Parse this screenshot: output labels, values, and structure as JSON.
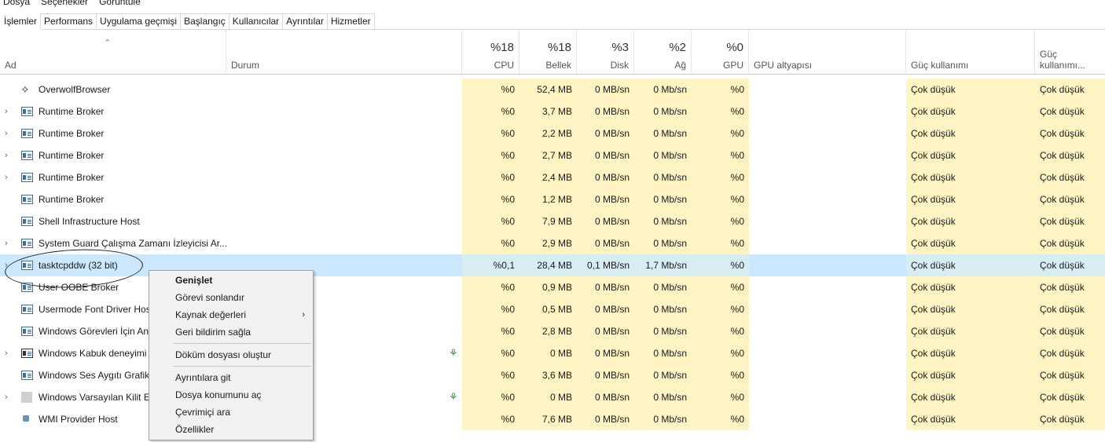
{
  "menu": [
    "Dosya",
    "Seçenekler",
    "Görüntüle"
  ],
  "tabs": [
    "İşlemler",
    "Performans",
    "Uygulama geçmişi",
    "Başlangıç",
    "Kullanıcılar",
    "Ayrıntılar",
    "Hizmetler"
  ],
  "columns": {
    "name": "Ad",
    "status": "Durum",
    "cpu": {
      "pct": "%18",
      "label": "CPU"
    },
    "memory": {
      "pct": "%18",
      "label": "Bellek"
    },
    "disk": {
      "pct": "%3",
      "label": "Disk"
    },
    "network": {
      "pct": "%2",
      "label": "Ağ"
    },
    "gpu": {
      "pct": "%0",
      "label": "GPU"
    },
    "gpu_engine": "GPU altyapısı",
    "power": "Güç kullanımı",
    "power_trend": "Güç kullanımı..."
  },
  "rows": [
    {
      "name": "OverwolfBrowser",
      "expand": false,
      "icon": "overwolf",
      "leaf": false,
      "cpu": "%0",
      "mem": "52,4 MB",
      "disk": "0 MB/sn",
      "net": "0 Mb/sn",
      "gpu": "%0",
      "power": "Çok düşük",
      "power2": "Çok düşük",
      "selected": false
    },
    {
      "name": "Runtime Broker",
      "expand": true,
      "icon": "process",
      "leaf": false,
      "cpu": "%0",
      "mem": "3,7 MB",
      "disk": "0 MB/sn",
      "net": "0 Mb/sn",
      "gpu": "%0",
      "power": "Çok düşük",
      "power2": "Çok düşük",
      "selected": false
    },
    {
      "name": "Runtime Broker",
      "expand": true,
      "icon": "process",
      "leaf": false,
      "cpu": "%0",
      "mem": "2,2 MB",
      "disk": "0 MB/sn",
      "net": "0 Mb/sn",
      "gpu": "%0",
      "power": "Çok düşük",
      "power2": "Çok düşük",
      "selected": false
    },
    {
      "name": "Runtime Broker",
      "expand": true,
      "icon": "process",
      "leaf": false,
      "cpu": "%0",
      "mem": "2,7 MB",
      "disk": "0 MB/sn",
      "net": "0 Mb/sn",
      "gpu": "%0",
      "power": "Çok düşük",
      "power2": "Çok düşük",
      "selected": false
    },
    {
      "name": "Runtime Broker",
      "expand": true,
      "icon": "process",
      "leaf": false,
      "cpu": "%0",
      "mem": "2,4 MB",
      "disk": "0 MB/sn",
      "net": "0 Mb/sn",
      "gpu": "%0",
      "power": "Çok düşük",
      "power2": "Çok düşük",
      "selected": false
    },
    {
      "name": "Runtime Broker",
      "expand": false,
      "icon": "process",
      "leaf": false,
      "cpu": "%0",
      "mem": "1,2 MB",
      "disk": "0 MB/sn",
      "net": "0 Mb/sn",
      "gpu": "%0",
      "power": "Çok düşük",
      "power2": "Çok düşük",
      "selected": false
    },
    {
      "name": "Shell Infrastructure Host",
      "expand": false,
      "icon": "process",
      "leaf": false,
      "cpu": "%0",
      "mem": "7,9 MB",
      "disk": "0 MB/sn",
      "net": "0 Mb/sn",
      "gpu": "%0",
      "power": "Çok düşük",
      "power2": "Çok düşük",
      "selected": false
    },
    {
      "name": "System Guard Çalışma Zamanı İzleyicisi Ar...",
      "expand": true,
      "icon": "process",
      "leaf": false,
      "cpu": "%0",
      "mem": "2,9 MB",
      "disk": "0 MB/sn",
      "net": "0 Mb/sn",
      "gpu": "%0",
      "power": "Çok düşük",
      "power2": "Çok düşük",
      "selected": false
    },
    {
      "name": "tasktcpddw (32 bit)",
      "expand": true,
      "icon": "process",
      "leaf": false,
      "cpu": "%0,1",
      "mem": "28,4 MB",
      "disk": "0,1 MB/sn",
      "net": "1,7 Mb/sn",
      "gpu": "%0",
      "power": "Çok düşük",
      "power2": "Çok düşük",
      "selected": true
    },
    {
      "name": "User OOBE Broker",
      "expand": false,
      "icon": "process",
      "leaf": false,
      "cpu": "%0",
      "mem": "0,9 MB",
      "disk": "0 MB/sn",
      "net": "0 Mb/sn",
      "gpu": "%0",
      "power": "Çok düşük",
      "power2": "Çok düşük",
      "selected": false
    },
    {
      "name": "Usermode Font Driver Host",
      "expand": false,
      "icon": "process",
      "leaf": false,
      "cpu": "%0",
      "mem": "0,5 MB",
      "disk": "0 MB/sn",
      "net": "0 Mb/sn",
      "gpu": "%0",
      "power": "Çok düşük",
      "power2": "Çok düşük",
      "selected": false
    },
    {
      "name": "Windows Görevleri İçin Ana",
      "expand": false,
      "icon": "process",
      "leaf": false,
      "cpu": "%0",
      "mem": "2,8 MB",
      "disk": "0 MB/sn",
      "net": "0 Mb/sn",
      "gpu": "%0",
      "power": "Çok düşük",
      "power2": "Çok düşük",
      "selected": false
    },
    {
      "name": "Windows Kabuk deneyimi",
      "expand": true,
      "icon": "window",
      "leaf": true,
      "cpu": "%0",
      "mem": "0 MB",
      "disk": "0 MB/sn",
      "net": "0 Mb/sn",
      "gpu": "%0",
      "power": "Çok düşük",
      "power2": "Çok düşük",
      "selected": false
    },
    {
      "name": "Windows Ses Aygıtı Grafik",
      "expand": false,
      "icon": "process",
      "leaf": false,
      "cpu": "%0",
      "mem": "3,6 MB",
      "disk": "0 MB/sn",
      "net": "0 Mb/sn",
      "gpu": "%0",
      "power": "Çok düşük",
      "power2": "Çok düşük",
      "selected": false
    },
    {
      "name": "Windows Varsayılan Kilit Ek",
      "expand": true,
      "icon": "plain",
      "leaf": true,
      "cpu": "%0",
      "mem": "0 MB",
      "disk": "0 MB/sn",
      "net": "0 Mb/sn",
      "gpu": "%0",
      "power": "Çok düşük",
      "power2": "Çok düşük",
      "selected": false
    },
    {
      "name": "WMI Provider Host",
      "expand": false,
      "icon": "wmi",
      "leaf": false,
      "cpu": "%0",
      "mem": "7,6 MB",
      "disk": "0 MB/sn",
      "net": "0 Mb/sn",
      "gpu": "%0",
      "power": "Çok düşük",
      "power2": "Çok düşük",
      "selected": false
    }
  ],
  "context_menu": [
    {
      "label": "Genişlet",
      "bold": true
    },
    {
      "label": "Görevi sonlandır"
    },
    {
      "label": "Kaynak değerleri",
      "submenu": true
    },
    {
      "label": "Geri bildirim sağla"
    },
    {
      "separator": true
    },
    {
      "label": "Döküm dosyası oluştur"
    },
    {
      "separator": true
    },
    {
      "label": "Ayrıntılara git"
    },
    {
      "label": "Dosya konumunu aç"
    },
    {
      "label": "Çevrimiçi ara"
    },
    {
      "label": "Özellikler"
    }
  ]
}
